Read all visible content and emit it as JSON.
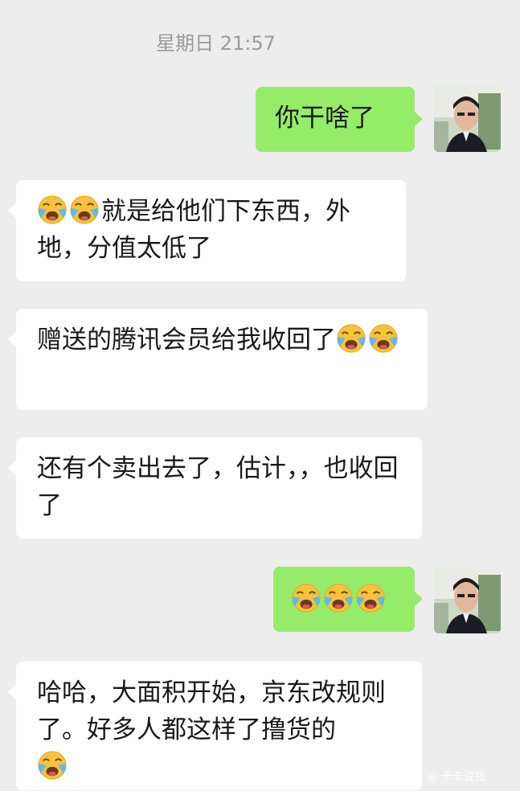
{
  "timestamp": "星期日 21:57",
  "messages": [
    {
      "side": "right",
      "text": "你干啥了",
      "emoji_before": 0,
      "emoji_after": 0
    },
    {
      "side": "left",
      "text": "就是给他们下东西，外地，分值太低了",
      "emoji_before": 2,
      "emoji_after": 0
    },
    {
      "side": "left",
      "text": "赠送的腾讯会员给我收回了",
      "emoji_before": 0,
      "emoji_after": 2
    },
    {
      "side": "left",
      "text": "还有个卖出去了，估计，，也收回了",
      "emoji_before": 0,
      "emoji_after": 0
    },
    {
      "side": "right",
      "text": "",
      "emoji_before": 3,
      "emoji_after": 0
    },
    {
      "side": "left",
      "text": "哈哈，大面积开始，京东改规则了。好多人都这样了撸货的",
      "emoji_before": 0,
      "emoji_after": 1
    }
  ],
  "emoji_name": "loudly-crying-emoji",
  "watermark": "卡卡说钱",
  "colors": {
    "background": "#ededed",
    "incoming": "#ffffff",
    "outgoing": "#95ec69",
    "text": "#191919"
  }
}
